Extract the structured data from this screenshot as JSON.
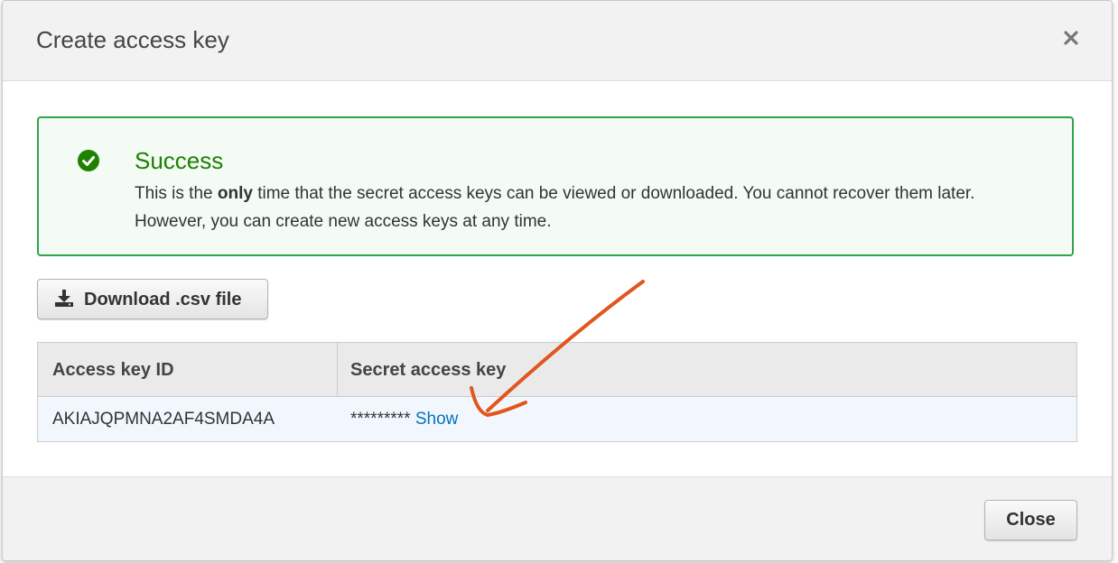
{
  "modal": {
    "title": "Create access key",
    "close_icon": "close-icon"
  },
  "alert": {
    "icon": "check-circle-icon",
    "heading": "Success",
    "body_before": "This is the ",
    "body_bold": "only",
    "body_after": " time that the secret access keys can be viewed or downloaded. You cannot recover them later. However, you can create new access keys at any time."
  },
  "download": {
    "icon": "download-icon",
    "label": "Download .csv file"
  },
  "table": {
    "columns": [
      "Access key ID",
      "Secret access key"
    ],
    "rows": [
      {
        "access_key_id": "AKIAJQPMNA2AF4SMDA4A",
        "secret_masked": "*********",
        "show_label": "Show"
      }
    ]
  },
  "footer": {
    "close_label": "Close"
  },
  "colors": {
    "success": "#1d8102",
    "success_border": "#2ea44f",
    "link": "#0073bb",
    "annotation": "#e0561d"
  }
}
